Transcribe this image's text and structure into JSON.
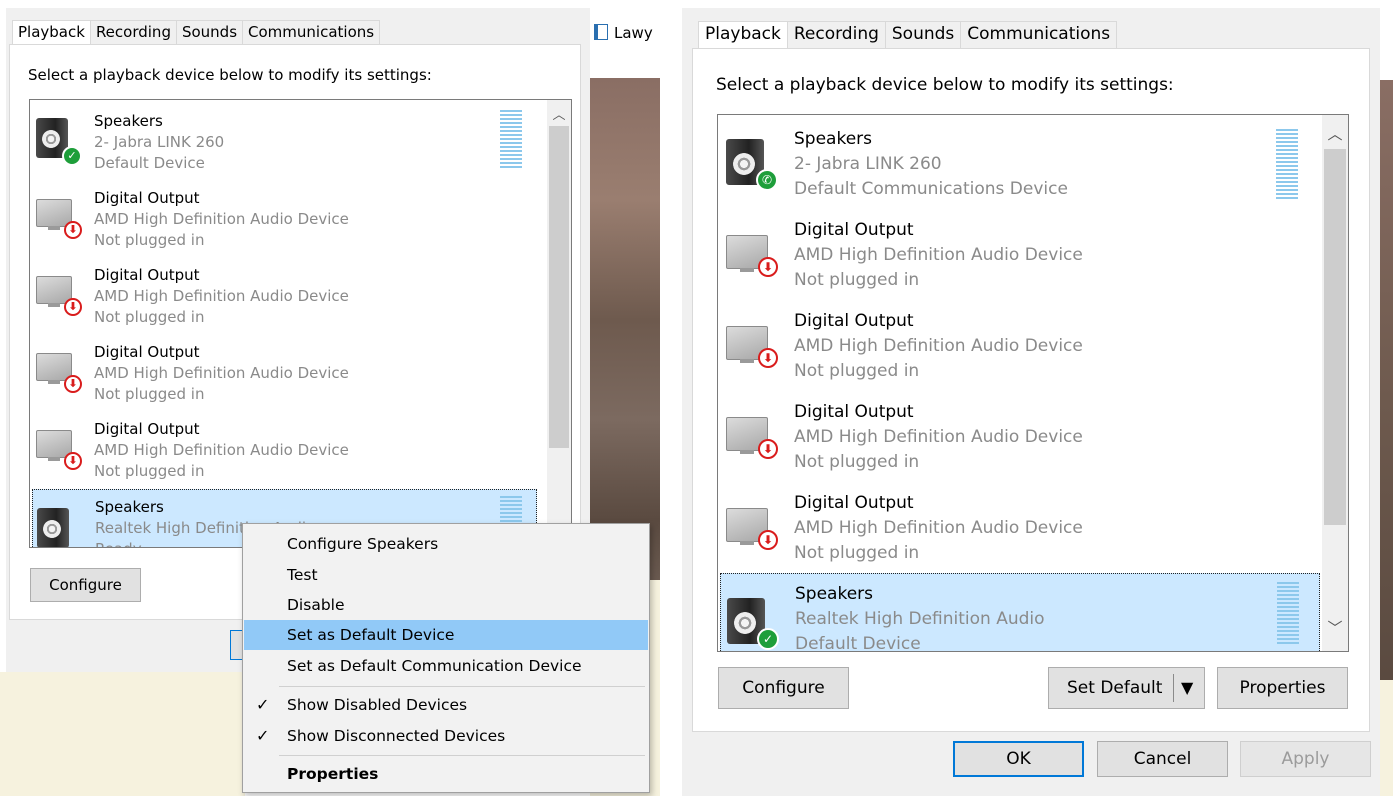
{
  "left_dialog": {
    "tabs": [
      "Playback",
      "Recording",
      "Sounds",
      "Communications"
    ],
    "instruction": "Select a playback device below to modify its settings:",
    "devices": [
      {
        "name": "Speakers",
        "line2": "2- Jabra LINK 260",
        "line3": "Default Device",
        "icon": "speaker-icon",
        "badge": "default-check-icon"
      },
      {
        "name": "Digital Output",
        "line2": "AMD High Definition Audio Device",
        "line3": "Not plugged in",
        "icon": "monitor-icon",
        "badge": "unplugged-arrow-icon"
      },
      {
        "name": "Digital Output",
        "line2": "AMD High Definition Audio Device",
        "line3": "Not plugged in",
        "icon": "monitor-icon",
        "badge": "unplugged-arrow-icon"
      },
      {
        "name": "Digital Output",
        "line2": "AMD High Definition Audio Device",
        "line3": "Not plugged in",
        "icon": "monitor-icon",
        "badge": "unplugged-arrow-icon"
      },
      {
        "name": "Digital Output",
        "line2": "AMD High Definition Audio Device",
        "line3": "Not plugged in",
        "icon": "monitor-icon",
        "badge": "unplugged-arrow-icon"
      },
      {
        "name": "Speakers",
        "line2": "Realtek High Definition Audio",
        "line3": "Ready",
        "icon": "speaker-icon",
        "badge": ""
      }
    ],
    "configure_label": "Configure"
  },
  "context_menu": {
    "items": [
      {
        "label": "Configure Speakers"
      },
      {
        "label": "Test"
      },
      {
        "label": "Disable"
      },
      {
        "label": "Set as Default Device",
        "highlighted": true
      },
      {
        "label": "Set as Default Communication Device"
      },
      {
        "label": "Show Disabled Devices",
        "checked": true
      },
      {
        "label": "Show Disconnected Devices",
        "checked": true
      },
      {
        "label": "Properties",
        "bold": true
      }
    ]
  },
  "background_app": {
    "title_fragment": "Lawy"
  },
  "right_dialog": {
    "tabs": [
      "Playback",
      "Recording",
      "Sounds",
      "Communications"
    ],
    "instruction": "Select a playback device below to modify its settings:",
    "devices": [
      {
        "name": "Speakers",
        "line2": "2- Jabra LINK 260",
        "line3": "Default Communications Device",
        "icon": "speaker-icon",
        "badge": "phone-icon"
      },
      {
        "name": "Digital Output",
        "line2": "AMD High Definition Audio Device",
        "line3": "Not plugged in",
        "icon": "monitor-icon",
        "badge": "unplugged-arrow-icon"
      },
      {
        "name": "Digital Output",
        "line2": "AMD High Definition Audio Device",
        "line3": "Not plugged in",
        "icon": "monitor-icon",
        "badge": "unplugged-arrow-icon"
      },
      {
        "name": "Digital Output",
        "line2": "AMD High Definition Audio Device",
        "line3": "Not plugged in",
        "icon": "monitor-icon",
        "badge": "unplugged-arrow-icon"
      },
      {
        "name": "Digital Output",
        "line2": "AMD High Definition Audio Device",
        "line3": "Not plugged in",
        "icon": "monitor-icon",
        "badge": "unplugged-arrow-icon"
      },
      {
        "name": "Speakers",
        "line2": "Realtek High Definition Audio",
        "line3": "Default Device",
        "icon": "speaker-icon",
        "badge": "default-check-icon"
      }
    ],
    "buttons": {
      "configure": "Configure",
      "set_default": "Set Default",
      "properties": "Properties",
      "ok": "OK",
      "cancel": "Cancel",
      "apply": "Apply"
    }
  },
  "colors": {
    "selection": "#cce8ff",
    "menu_highlight": "#91c9f7",
    "meter": "#8cc8ec",
    "default_badge": "#1e9e3a",
    "unplugged_badge": "#d91c1c"
  }
}
